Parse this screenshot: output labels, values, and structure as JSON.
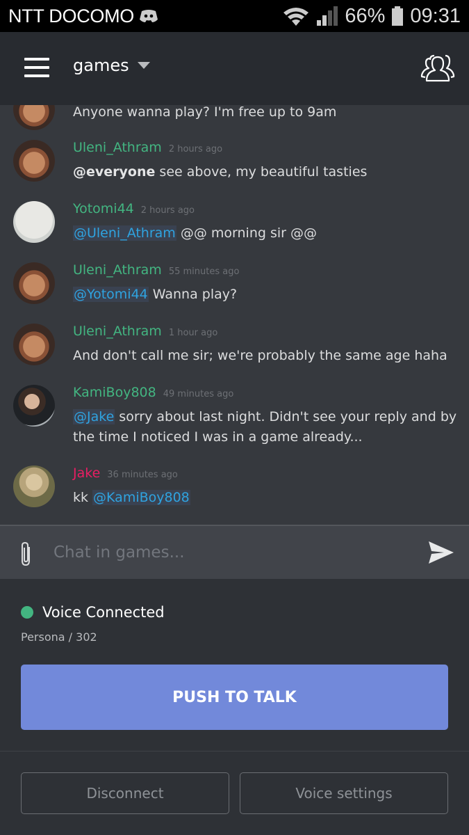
{
  "status_bar": {
    "carrier": "NTT DOCOMO",
    "notification_icon": "discord-icon",
    "wifi_icon": "wifi-icon",
    "signal_icon": "signal-icon",
    "signal_bars": 2,
    "signal_bars_total": 4,
    "battery_percent": "66%",
    "time": "09:31"
  },
  "header": {
    "menu_icon": "hamburger-icon",
    "channel_name": "games",
    "dropdown_icon": "caret-down-icon",
    "members_icon": "members-icon"
  },
  "messages": [
    {
      "author": "",
      "timestamp": "",
      "avatar": "uleni",
      "partial": true,
      "parts": [
        {
          "type": "text",
          "value": "Anyone wanna play? I'm free up to 9am"
        }
      ]
    },
    {
      "author": "Uleni_Athram",
      "timestamp": "2 hours ago",
      "avatar": "uleni",
      "name_color": "#43b581",
      "parts": [
        {
          "type": "everyone",
          "value": "@everyone"
        },
        {
          "type": "text",
          "value": " see above, my beautiful tasties"
        }
      ]
    },
    {
      "author": "Yotomi44",
      "timestamp": "2 hours ago",
      "avatar": "yotomi",
      "name_color": "#43b581",
      "parts": [
        {
          "type": "mention",
          "value": "@Uleni_Athram"
        },
        {
          "type": "text",
          "value": " @@ morning sir @@"
        }
      ]
    },
    {
      "author": "Uleni_Athram",
      "timestamp": "55 minutes ago",
      "avatar": "uleni",
      "name_color": "#43b581",
      "parts": [
        {
          "type": "mention",
          "value": "@Yotomi44"
        },
        {
          "type": "text",
          "value": " Wanna play?"
        }
      ]
    },
    {
      "author": "Uleni_Athram",
      "timestamp": "1 hour ago",
      "avatar": "uleni",
      "name_color": "#43b581",
      "parts": [
        {
          "type": "text",
          "value": "And don't call me sir; we're probably the same age haha"
        }
      ]
    },
    {
      "author": "KamiBoy808",
      "timestamp": "49 minutes ago",
      "avatar": "kami",
      "name_color": "#43b581",
      "parts": [
        {
          "type": "mention",
          "value": "@Jake"
        },
        {
          "type": "text",
          "value": " sorry about last night. Didn't see your reply and by the time I noticed I was in a game already..."
        }
      ]
    },
    {
      "author": "Jake",
      "timestamp": "36 minutes ago",
      "avatar": "jake",
      "name_color": "#e91e63",
      "parts": [
        {
          "type": "text",
          "value": "kk "
        },
        {
          "type": "mention",
          "value": "@KamiBoy808"
        }
      ]
    }
  ],
  "composer": {
    "attach_icon": "paperclip-icon",
    "placeholder": "Chat in games...",
    "value": "",
    "send_icon": "send-icon"
  },
  "voice": {
    "status": "Voice Connected",
    "status_color": "#43b581",
    "channel": "Persona / 302",
    "push_to_talk_label": "PUSH TO TALK",
    "disconnect_label": "Disconnect",
    "settings_label": "Voice settings"
  },
  "colors": {
    "accent": "#7289da",
    "online": "#43b581",
    "mention": "#2fa3e0",
    "role_pink": "#e91e63"
  }
}
